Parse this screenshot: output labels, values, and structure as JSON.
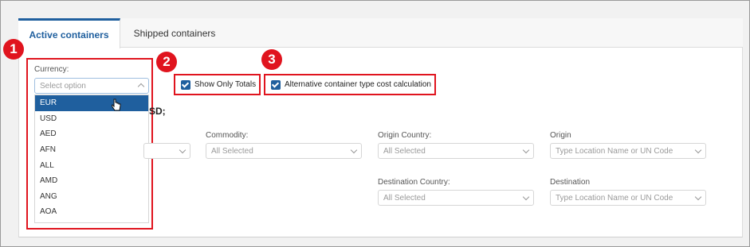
{
  "tabs": [
    {
      "label": "Active containers",
      "active": true
    },
    {
      "label": "Shipped containers",
      "active": false
    }
  ],
  "badges": [
    "1",
    "2",
    "3"
  ],
  "currency": {
    "label": "Currency:",
    "placeholder": "Select option",
    "options": [
      "EUR",
      "USD",
      "AED",
      "AFN",
      "ALL",
      "AMD",
      "ANG",
      "AOA"
    ],
    "selected": "EUR"
  },
  "checkboxes": {
    "show_totals": {
      "label": "Show Only Totals",
      "checked": true
    },
    "alt_cost": {
      "label": "Alternative container type cost calculation",
      "checked": true
    }
  },
  "partial_text": "SD;",
  "filters": {
    "commodity": {
      "label": "Commodity:",
      "value": "All Selected"
    },
    "origin_country": {
      "label": "Origin Country:",
      "value": "All Selected"
    },
    "origin": {
      "label": "Origin",
      "placeholder": "Type Location Name or UN Code"
    },
    "destination_country": {
      "label": "Destination Country:",
      "value": "All Selected"
    },
    "destination": {
      "label": "Destination",
      "placeholder": "Type Location Name or UN Code"
    }
  },
  "colors": {
    "accent": "#1f5f9e",
    "annotation": "#e0141e"
  }
}
